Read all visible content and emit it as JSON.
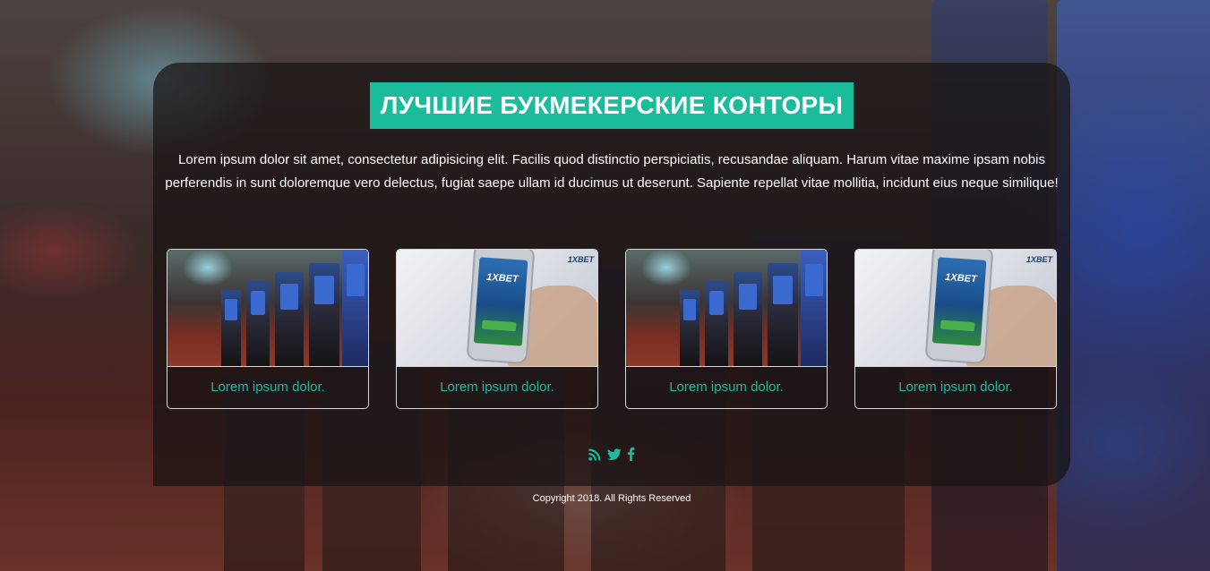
{
  "hero": {
    "title": "ЛУЧШИЕ БУКМЕКЕРСКИЕ КОНТОРЫ",
    "intro": "Lorem ipsum dolor sit amet, consectetur adipisicing elit. Facilis quod distinctio perspiciatis, recusandae aliquam. Harum vitae maxime ipsam nobis perferendis in sunt doloremque vero delectus, fugiat saepe ullam id ducimus ut deserunt. Sapiente repellat vitae mollitia, incidunt eius neque similique!"
  },
  "cards": [
    {
      "label": "Lorem ipsum dolor.",
      "image": "casino-slot-machines-photo"
    },
    {
      "label": "Lorem ipsum dolor.",
      "image": "1xbet-phone-photo",
      "brand": "1XBET",
      "screen_logo": "1XBET"
    },
    {
      "label": "Lorem ipsum dolor.",
      "image": "casino-slot-machines-photo"
    },
    {
      "label": "Lorem ipsum dolor.",
      "image": "1xbet-phone-photo",
      "brand": "1XBET",
      "screen_logo": "1XBET"
    }
  ],
  "social": {
    "icons": [
      "rss-icon",
      "twitter-icon",
      "facebook-icon"
    ],
    "color": "#1abc9c"
  },
  "footer": {
    "copyright": "Copyright 2018. All Rights Reserved"
  },
  "colors": {
    "accent": "#1abc9c",
    "text": "#ffffff"
  }
}
